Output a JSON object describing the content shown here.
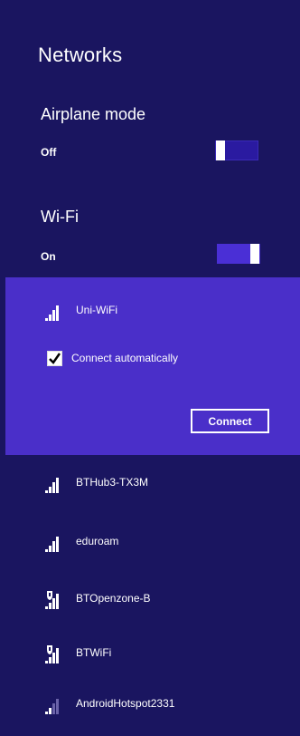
{
  "panel": {
    "title": "Networks"
  },
  "airplane": {
    "label": "Airplane mode",
    "state": "Off"
  },
  "wifi": {
    "label": "Wi-Fi",
    "state": "On"
  },
  "selected_network": {
    "name": "Uni-WiFi",
    "connect_auto_label": "Connect automatically",
    "connect_auto_checked": true,
    "connect_label": "Connect"
  },
  "networks": [
    {
      "name": "BTHub3-TX3M",
      "secured": false,
      "signal_bars": 4
    },
    {
      "name": "eduroam",
      "secured": false,
      "signal_bars": 4
    },
    {
      "name": "BTOpenzone-B",
      "secured": true,
      "signal_bars": 4
    },
    {
      "name": "BTWiFi",
      "secured": true,
      "signal_bars": 4
    },
    {
      "name": "AndroidHotspot2331",
      "secured": false,
      "signal_bars": 2
    }
  ],
  "colors": {
    "background": "#1a1560",
    "selected_background": "#4a2fc9",
    "toggle_on": "#4a2fd6",
    "toggle_off": "#2a1aa0"
  }
}
